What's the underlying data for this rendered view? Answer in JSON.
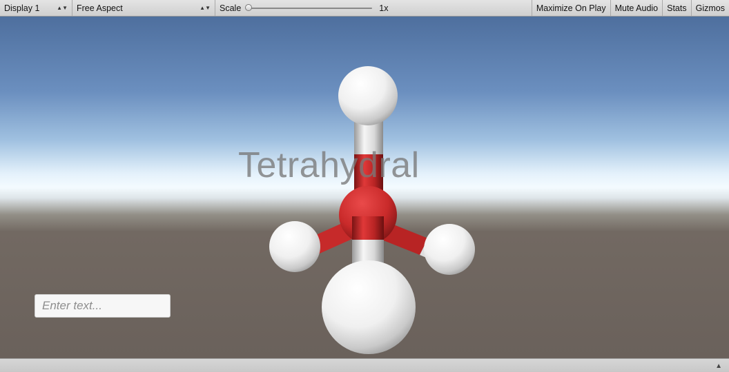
{
  "toolbar": {
    "display_label": "Display 1",
    "aspect_label": "Free Aspect",
    "scale_label": "Scale",
    "scale_value": "1x",
    "maximize_label": "Maximize On Play",
    "mute_label": "Mute Audio",
    "stats_label": "Stats",
    "gizmos_label": "Gizmos"
  },
  "viewport": {
    "overlay_label": "Tetrahydral",
    "input_placeholder": "Enter text...",
    "input_value": ""
  },
  "colors": {
    "central_atom": "#c92a2a",
    "outer_atom": "#f2f2f2",
    "sky_top": "#4e6f9e",
    "ground": "#6a615b"
  },
  "icons": {
    "dropdown": "updown-arrows-icon",
    "corner": "triangle-icon"
  }
}
